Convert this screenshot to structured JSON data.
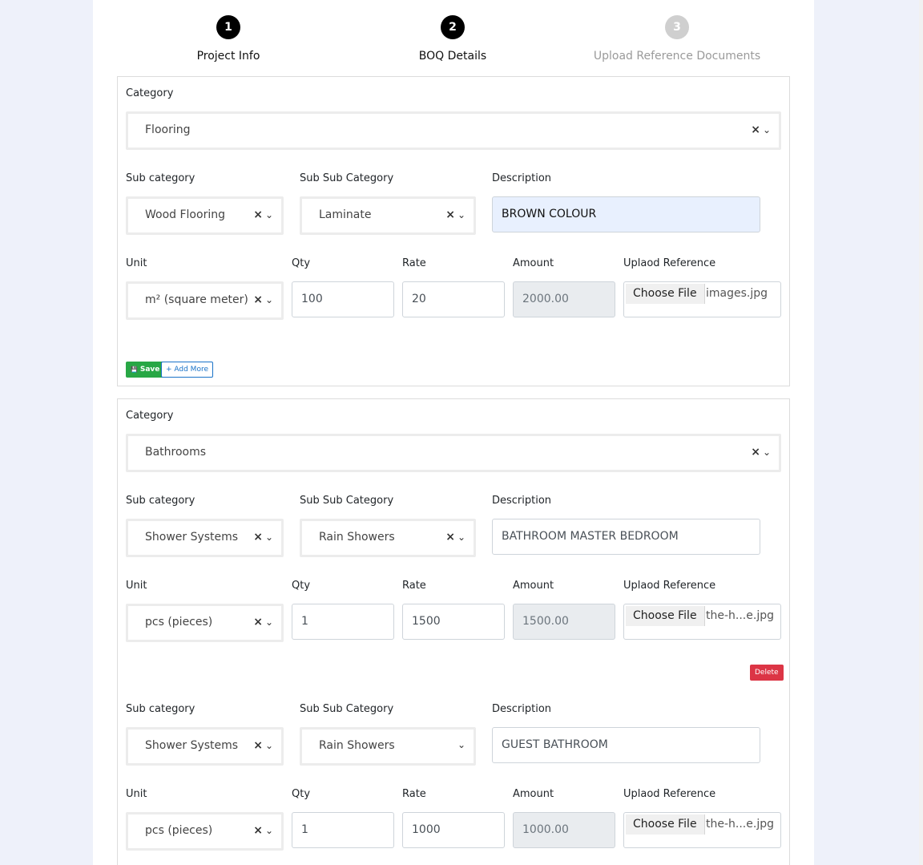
{
  "steps": [
    {
      "num": "1",
      "label": "Project Info"
    },
    {
      "num": "2",
      "label": "BOQ Details"
    },
    {
      "num": "3",
      "label": "Upload Reference Documents"
    }
  ],
  "labels": {
    "category": "Category",
    "sub_category": "Sub category",
    "sub_sub_category": "Sub Sub Category",
    "description": "Description",
    "unit": "Unit",
    "qty": "Qty",
    "rate": "Rate",
    "amount": "Amount",
    "upload": "Uplaod Reference",
    "choose_file": "Choose File"
  },
  "icons": {
    "clear": "×",
    "chevron": "⌄",
    "save": "💾"
  },
  "card1": {
    "category": "Flooring",
    "sub_category": "Wood Flooring",
    "sub_sub_category": "Laminate",
    "description": "BROWN COLOUR",
    "unit": "m² (square meter)",
    "qty": "100",
    "rate": "20",
    "amount": "2000.00",
    "file": "images.jpg",
    "save_label": "Save",
    "add_label": "+ Add More"
  },
  "card2": {
    "category": "Bathrooms",
    "items": [
      {
        "sub_category": "Shower Systems",
        "sub_sub_category": "Rain Showers",
        "description": "BATHROOM MASTER BEDROOM",
        "unit": "pcs (pieces)",
        "qty": "1",
        "rate": "1500",
        "amount": "1500.00",
        "file": "the-h...e.jpg"
      },
      {
        "sub_category": "Shower Systems",
        "sub_sub_category": "Rain Showers",
        "description": "GUEST BATHROOM",
        "unit": "pcs (pieces)",
        "qty": "1",
        "rate": "1000",
        "amount": "1000.00",
        "file": "the-h...e.jpg"
      }
    ],
    "delete_label": "Delete"
  }
}
